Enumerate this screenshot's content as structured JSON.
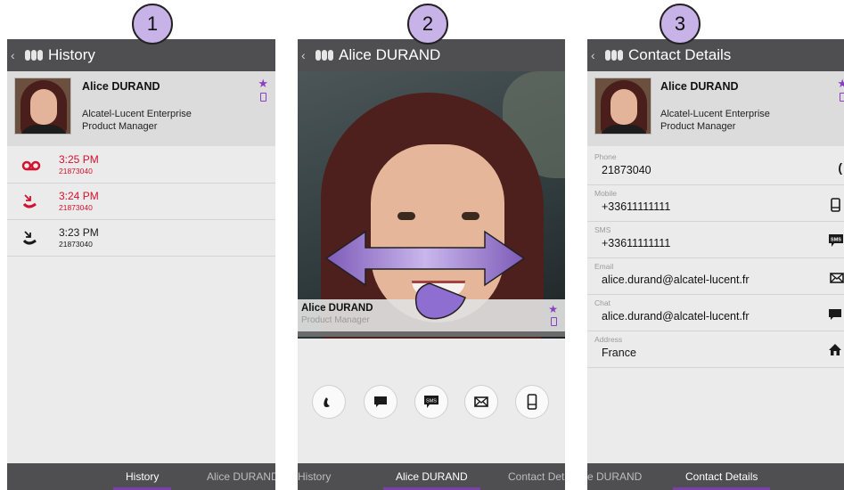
{
  "badges": [
    "1",
    "2",
    "3"
  ],
  "contact": {
    "name": "Alice DURAND",
    "company": "Alcatel-Lucent Enterprise",
    "title": "Product Manager"
  },
  "panel1": {
    "title": "History",
    "history": [
      {
        "icon": "voicemail-icon",
        "time": "3:25 PM",
        "number": "21873040",
        "color": "#d3102e"
      },
      {
        "icon": "missed-call-icon",
        "time": "3:24 PM",
        "number": "21873040",
        "color": "#d3102e"
      },
      {
        "icon": "incoming-call-icon",
        "time": "3:23 PM",
        "number": "21873040",
        "color": "#1a1a1a"
      }
    ],
    "tabs": [
      "History",
      "Alice DURAND"
    ]
  },
  "panel2": {
    "title": "Alice DURAND",
    "tabs": [
      "History",
      "Alice DURAND",
      "Contact Det"
    ],
    "actions": [
      "phone-icon",
      "chat-icon",
      "sms-icon",
      "email-icon",
      "mobile-icon"
    ]
  },
  "panel3": {
    "title": "Contact Details",
    "fields": [
      {
        "label": "Phone",
        "value": "21873040",
        "icon": "phone-icon"
      },
      {
        "label": "Mobile",
        "value": "+33611111111",
        "icon": "mobile-icon"
      },
      {
        "label": "SMS",
        "value": "+33611111111",
        "icon": "sms-icon"
      },
      {
        "label": "Email",
        "value": "alice.durand@alcatel-lucent.fr",
        "icon": "email-icon"
      },
      {
        "label": "Chat",
        "value": "alice.durand@alcatel-lucent.fr",
        "icon": "chat-icon"
      },
      {
        "label": "Address",
        "value": "France",
        "icon": "home-icon"
      }
    ],
    "tabs": [
      "e DURAND",
      "Contact Details"
    ]
  },
  "colors": {
    "accent": "#8a3fc0",
    "titlebar": "#4f4f51",
    "missed": "#d3102e",
    "badge": "#c7b3e8"
  }
}
